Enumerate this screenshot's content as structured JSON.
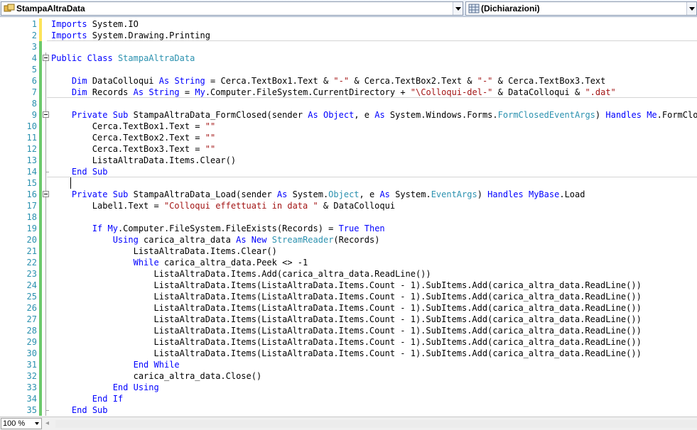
{
  "navigation": {
    "class_dropdown": {
      "value": "StampaAltraData",
      "icon": "class-icon"
    },
    "member_dropdown": {
      "value": "(Dichiarazioni)",
      "icon": "declarations-icon"
    }
  },
  "editor": {
    "lines": [
      {
        "n": "1",
        "tokens": [
          [
            "kw",
            "Imports"
          ],
          [
            "txt",
            " System.IO"
          ]
        ]
      },
      {
        "n": "2",
        "tokens": [
          [
            "kw",
            "Imports"
          ],
          [
            "txt",
            " System.Drawing.Printing"
          ]
        ]
      },
      {
        "n": "3",
        "tokens": []
      },
      {
        "n": "4",
        "tokens": [
          [
            "kw",
            "Public"
          ],
          [
            "txt",
            " "
          ],
          [
            "kw",
            "Class"
          ],
          [
            "txt",
            " "
          ],
          [
            "type",
            "StampaAltraData"
          ]
        ]
      },
      {
        "n": "5",
        "tokens": []
      },
      {
        "n": "6",
        "tokens": [
          [
            "txt",
            "    "
          ],
          [
            "kw",
            "Dim"
          ],
          [
            "txt",
            " DataColloqui "
          ],
          [
            "kw",
            "As"
          ],
          [
            "txt",
            " "
          ],
          [
            "kw",
            "String"
          ],
          [
            "txt",
            " = Cerca.TextBox1.Text & "
          ],
          [
            "str",
            "\"-\""
          ],
          [
            "txt",
            " & Cerca.TextBox2.Text & "
          ],
          [
            "str",
            "\"-\""
          ],
          [
            "txt",
            " & Cerca.TextBox3.Text"
          ]
        ]
      },
      {
        "n": "7",
        "tokens": [
          [
            "txt",
            "    "
          ],
          [
            "kw",
            "Dim"
          ],
          [
            "txt",
            " Records "
          ],
          [
            "kw",
            "As"
          ],
          [
            "txt",
            " "
          ],
          [
            "kw",
            "String"
          ],
          [
            "txt",
            " = "
          ],
          [
            "kw",
            "My"
          ],
          [
            "txt",
            ".Computer.FileSystem.CurrentDirectory + "
          ],
          [
            "str",
            "\"\\Colloqui-del-\""
          ],
          [
            "txt",
            " & DataColloqui & "
          ],
          [
            "str",
            "\".dat\""
          ]
        ]
      },
      {
        "n": "8",
        "tokens": []
      },
      {
        "n": "9",
        "tokens": [
          [
            "txt",
            "    "
          ],
          [
            "kw",
            "Private"
          ],
          [
            "txt",
            " "
          ],
          [
            "kw",
            "Sub"
          ],
          [
            "txt",
            " StampaAltraData_FormClosed(sender "
          ],
          [
            "kw",
            "As"
          ],
          [
            "txt",
            " "
          ],
          [
            "kw",
            "Object"
          ],
          [
            "txt",
            ", e "
          ],
          [
            "kw",
            "As"
          ],
          [
            "txt",
            " System.Windows.Forms."
          ],
          [
            "type",
            "FormClosedEventArgs"
          ],
          [
            "txt",
            ") "
          ],
          [
            "kw",
            "Handles"
          ],
          [
            "txt",
            " "
          ],
          [
            "kw",
            "Me"
          ],
          [
            "txt",
            ".FormClosed"
          ]
        ]
      },
      {
        "n": "10",
        "tokens": [
          [
            "txt",
            "        Cerca.TextBox1.Text = "
          ],
          [
            "str",
            "\"\""
          ]
        ]
      },
      {
        "n": "11",
        "tokens": [
          [
            "txt",
            "        Cerca.TextBox2.Text = "
          ],
          [
            "str",
            "\"\""
          ]
        ]
      },
      {
        "n": "12",
        "tokens": [
          [
            "txt",
            "        Cerca.TextBox3.Text = "
          ],
          [
            "str",
            "\"\""
          ]
        ]
      },
      {
        "n": "13",
        "tokens": [
          [
            "txt",
            "        ListaAltraData.Items.Clear()"
          ]
        ]
      },
      {
        "n": "14",
        "tokens": [
          [
            "txt",
            "    "
          ],
          [
            "kw",
            "End"
          ],
          [
            "txt",
            " "
          ],
          [
            "kw",
            "Sub"
          ]
        ]
      },
      {
        "n": "15",
        "tokens": []
      },
      {
        "n": "16",
        "tokens": [
          [
            "txt",
            "    "
          ],
          [
            "kw",
            "Private"
          ],
          [
            "txt",
            " "
          ],
          [
            "kw",
            "Sub"
          ],
          [
            "txt",
            " StampaAltraData_Load(sender "
          ],
          [
            "kw",
            "As"
          ],
          [
            "txt",
            " System."
          ],
          [
            "type",
            "Object"
          ],
          [
            "txt",
            ", e "
          ],
          [
            "kw",
            "As"
          ],
          [
            "txt",
            " System."
          ],
          [
            "type",
            "EventArgs"
          ],
          [
            "txt",
            ") "
          ],
          [
            "kw",
            "Handles"
          ],
          [
            "txt",
            " "
          ],
          [
            "kw",
            "MyBase"
          ],
          [
            "txt",
            ".Load"
          ]
        ]
      },
      {
        "n": "17",
        "tokens": [
          [
            "txt",
            "        Label1.Text = "
          ],
          [
            "str",
            "\"Colloqui effettuati in data \""
          ],
          [
            "txt",
            " & DataColloqui"
          ]
        ]
      },
      {
        "n": "18",
        "tokens": []
      },
      {
        "n": "19",
        "tokens": [
          [
            "txt",
            "        "
          ],
          [
            "kw",
            "If"
          ],
          [
            "txt",
            " "
          ],
          [
            "kw",
            "My"
          ],
          [
            "txt",
            ".Computer.FileSystem.FileExists(Records) = "
          ],
          [
            "kw",
            "True"
          ],
          [
            "txt",
            " "
          ],
          [
            "kw",
            "Then"
          ]
        ]
      },
      {
        "n": "20",
        "tokens": [
          [
            "txt",
            "            "
          ],
          [
            "kw",
            "Using"
          ],
          [
            "txt",
            " carica_altra_data "
          ],
          [
            "kw",
            "As"
          ],
          [
            "txt",
            " "
          ],
          [
            "kw",
            "New"
          ],
          [
            "txt",
            " "
          ],
          [
            "type",
            "StreamReader"
          ],
          [
            "txt",
            "(Records)"
          ]
        ]
      },
      {
        "n": "21",
        "tokens": [
          [
            "txt",
            "                ListaAltraData.Items.Clear()"
          ]
        ]
      },
      {
        "n": "22",
        "tokens": [
          [
            "txt",
            "                "
          ],
          [
            "kw",
            "While"
          ],
          [
            "txt",
            " carica_altra_data.Peek <> -1"
          ]
        ]
      },
      {
        "n": "23",
        "tokens": [
          [
            "txt",
            "                    ListaAltraData.Items.Add(carica_altra_data.ReadLine())"
          ]
        ]
      },
      {
        "n": "24",
        "tokens": [
          [
            "txt",
            "                    ListaAltraData.Items(ListaAltraData.Items.Count - 1).SubItems.Add(carica_altra_data.ReadLine())"
          ]
        ]
      },
      {
        "n": "25",
        "tokens": [
          [
            "txt",
            "                    ListaAltraData.Items(ListaAltraData.Items.Count - 1).SubItems.Add(carica_altra_data.ReadLine())"
          ]
        ]
      },
      {
        "n": "26",
        "tokens": [
          [
            "txt",
            "                    ListaAltraData.Items(ListaAltraData.Items.Count - 1).SubItems.Add(carica_altra_data.ReadLine())"
          ]
        ]
      },
      {
        "n": "27",
        "tokens": [
          [
            "txt",
            "                    ListaAltraData.Items(ListaAltraData.Items.Count - 1).SubItems.Add(carica_altra_data.ReadLine())"
          ]
        ]
      },
      {
        "n": "28",
        "tokens": [
          [
            "txt",
            "                    ListaAltraData.Items(ListaAltraData.Items.Count - 1).SubItems.Add(carica_altra_data.ReadLine())"
          ]
        ]
      },
      {
        "n": "29",
        "tokens": [
          [
            "txt",
            "                    ListaAltraData.Items(ListaAltraData.Items.Count - 1).SubItems.Add(carica_altra_data.ReadLine())"
          ]
        ]
      },
      {
        "n": "30",
        "tokens": [
          [
            "txt",
            "                    ListaAltraData.Items(ListaAltraData.Items.Count - 1).SubItems.Add(carica_altra_data.ReadLine())"
          ]
        ]
      },
      {
        "n": "31",
        "tokens": [
          [
            "txt",
            "                "
          ],
          [
            "kw",
            "End"
          ],
          [
            "txt",
            " "
          ],
          [
            "kw",
            "While"
          ]
        ]
      },
      {
        "n": "32",
        "tokens": [
          [
            "txt",
            "                carica_altra_data.Close()"
          ]
        ]
      },
      {
        "n": "33",
        "tokens": [
          [
            "txt",
            "            "
          ],
          [
            "kw",
            "End"
          ],
          [
            "txt",
            " "
          ],
          [
            "kw",
            "Using"
          ]
        ]
      },
      {
        "n": "34",
        "tokens": [
          [
            "txt",
            "        "
          ],
          [
            "kw",
            "End"
          ],
          [
            "txt",
            " "
          ],
          [
            "kw",
            "If"
          ]
        ]
      },
      {
        "n": "35",
        "tokens": [
          [
            "txt",
            "    "
          ],
          [
            "kw",
            "End"
          ],
          [
            "txt",
            " "
          ],
          [
            "kw",
            "Sub"
          ]
        ]
      }
    ]
  },
  "statusbar": {
    "zoom": "100 %"
  },
  "colors": {
    "keyword": "#0000ff",
    "type": "#2b91af",
    "string": "#a31515",
    "line_number": "#2b91af",
    "change_marker": "#6cc96c"
  }
}
